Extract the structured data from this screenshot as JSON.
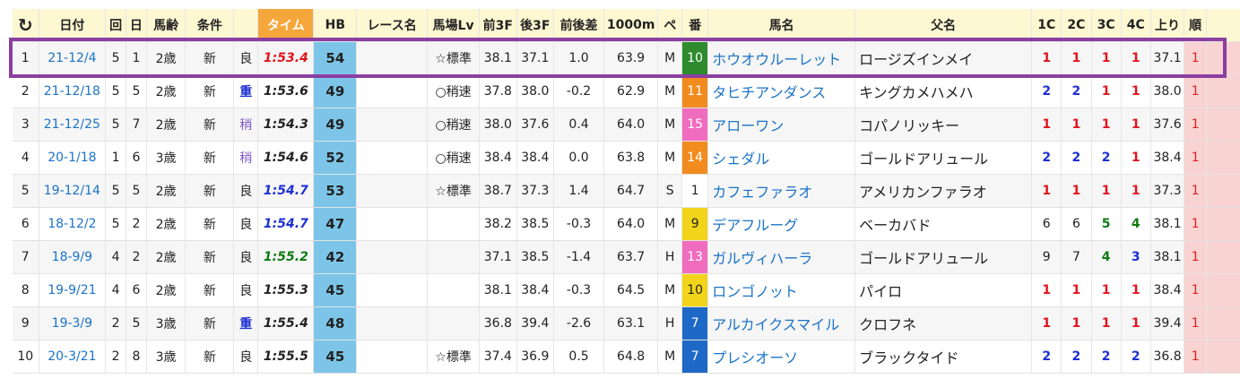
{
  "headers": {
    "refresh_icon": "↻",
    "date": "日付",
    "kai": "回",
    "day": "日",
    "age": "馬齢",
    "cond": "条件",
    "time": "タイム",
    "hb": "HB",
    "race_name": "レース名",
    "track_lv": "馬場Lv",
    "f3": "前3F",
    "l3": "後3F",
    "diff": "前後差",
    "m1000": "1000m",
    "pe": "ペ",
    "num": "番",
    "horse": "馬名",
    "sire": "父名",
    "c1": "1C",
    "c2": "2C",
    "c3": "3C",
    "c4": "4C",
    "agari": "上り",
    "rank": "順"
  },
  "colors": {
    "time_header": "#f5a73b",
    "hb_cell": "#7cc5e8",
    "rank_cell": "#f9d2d2",
    "highlight_border": "#8b3ea0"
  },
  "rows": [
    {
      "idx": "1",
      "date": "21-12/4",
      "kai": "5",
      "day": "1",
      "age": "2歳",
      "cond": "新",
      "track": "良",
      "time": "1:53.4",
      "time_color": "#e0141e",
      "hb": "54",
      "race_name": "",
      "lv": "☆標準",
      "f3": "38.1",
      "l3": "37.1",
      "diff": "1.0",
      "m1000": "63.9",
      "pe": "M",
      "num": "10",
      "num_bg": "#2e8b2e",
      "num_fg": "#ffffff",
      "horse": "ホウオウルーレット",
      "sire": "ロージズインメイ",
      "c1": "1",
      "c1c": "red",
      "c2": "1",
      "c2c": "red",
      "c3": "1",
      "c3c": "red",
      "c4": "1",
      "c4c": "red",
      "agari": "37.1",
      "rank": "1"
    },
    {
      "idx": "2",
      "date": "21-12/18",
      "kai": "5",
      "day": "5",
      "age": "2歳",
      "cond": "新",
      "track": "重",
      "time": "1:53.6",
      "time_color": "#222222",
      "hb": "49",
      "race_name": "",
      "lv": "○稍速",
      "f3": "37.8",
      "l3": "38.0",
      "diff": "-0.2",
      "m1000": "62.9",
      "pe": "M",
      "num": "11",
      "num_bg": "#f28c1e",
      "num_fg": "#ffffff",
      "horse": "タヒチアンダンス",
      "sire": "キングカメハメハ",
      "c1": "2",
      "c1c": "blue",
      "c2": "2",
      "c2c": "blue",
      "c3": "1",
      "c3c": "red",
      "c4": "1",
      "c4c": "red",
      "agari": "38.0",
      "rank": "1"
    },
    {
      "idx": "3",
      "date": "21-12/25",
      "kai": "5",
      "day": "7",
      "age": "2歳",
      "cond": "新",
      "track": "稍",
      "time": "1:54.3",
      "time_color": "#222222",
      "hb": "49",
      "race_name": "",
      "lv": "○稍速",
      "f3": "38.0",
      "l3": "37.6",
      "diff": "0.4",
      "m1000": "64.0",
      "pe": "M",
      "num": "15",
      "num_bg": "#f06cbf",
      "num_fg": "#ffffff",
      "horse": "アローワン",
      "sire": "コパノリッキー",
      "c1": "1",
      "c1c": "red",
      "c2": "1",
      "c2c": "red",
      "c3": "1",
      "c3c": "red",
      "c4": "1",
      "c4c": "red",
      "agari": "37.6",
      "rank": "1"
    },
    {
      "idx": "4",
      "date": "20-1/18",
      "kai": "1",
      "day": "6",
      "age": "3歳",
      "cond": "新",
      "track": "稍",
      "time": "1:54.6",
      "time_color": "#222222",
      "hb": "52",
      "race_name": "",
      "lv": "○稍速",
      "f3": "38.4",
      "l3": "38.4",
      "diff": "0.0",
      "m1000": "63.8",
      "pe": "M",
      "num": "14",
      "num_bg": "#f28c1e",
      "num_fg": "#ffffff",
      "horse": "シェダル",
      "sire": "ゴールドアリュール",
      "c1": "2",
      "c1c": "blue",
      "c2": "2",
      "c2c": "blue",
      "c3": "2",
      "c3c": "blue",
      "c4": "1",
      "c4c": "red",
      "agari": "38.4",
      "rank": "1"
    },
    {
      "idx": "5",
      "date": "19-12/14",
      "kai": "5",
      "day": "5",
      "age": "2歳",
      "cond": "新",
      "track": "良",
      "time": "1:54.7",
      "time_color": "#1c2fd4",
      "hb": "53",
      "race_name": "",
      "lv": "☆標準",
      "f3": "38.7",
      "l3": "37.3",
      "diff": "1.4",
      "m1000": "64.7",
      "pe": "S",
      "num": "1",
      "num_bg": "transparent",
      "num_fg": "#222222",
      "horse": "カフェファラオ",
      "sire": "アメリカンファラオ",
      "c1": "1",
      "c1c": "red",
      "c2": "1",
      "c2c": "red",
      "c3": "1",
      "c3c": "red",
      "c4": "1",
      "c4c": "red",
      "agari": "37.3",
      "rank": "1"
    },
    {
      "idx": "6",
      "date": "18-12/2",
      "kai": "5",
      "day": "2",
      "age": "2歳",
      "cond": "新",
      "track": "良",
      "time": "1:54.7",
      "time_color": "#1c2fd4",
      "hb": "47",
      "race_name": "",
      "lv": "",
      "f3": "38.2",
      "l3": "38.5",
      "diff": "-0.3",
      "m1000": "64.0",
      "pe": "M",
      "num": "9",
      "num_bg": "#f2d51a",
      "num_fg": "#222222",
      "horse": "デアフルーグ",
      "sire": "ベーカバド",
      "c1": "6",
      "c1c": "plain",
      "c2": "6",
      "c2c": "plain",
      "c3": "5",
      "c3c": "green",
      "c4": "4",
      "c4c": "green",
      "agari": "38.1",
      "rank": "1"
    },
    {
      "idx": "7",
      "date": "18-9/9",
      "kai": "4",
      "day": "2",
      "age": "2歳",
      "cond": "新",
      "track": "良",
      "time": "1:55.2",
      "time_color": "#0f7a12",
      "hb": "42",
      "race_name": "",
      "lv": "",
      "f3": "37.1",
      "l3": "38.5",
      "diff": "-1.4",
      "m1000": "63.7",
      "pe": "H",
      "num": "13",
      "num_bg": "#f06cbf",
      "num_fg": "#ffffff",
      "horse": "ガルヴィハーラ",
      "sire": "ゴールドアリュール",
      "c1": "9",
      "c1c": "plain",
      "c2": "7",
      "c2c": "plain",
      "c3": "4",
      "c3c": "green",
      "c4": "3",
      "c4c": "blue",
      "agari": "38.1",
      "rank": "1"
    },
    {
      "idx": "8",
      "date": "19-9/21",
      "kai": "4",
      "day": "6",
      "age": "2歳",
      "cond": "新",
      "track": "良",
      "time": "1:55.3",
      "time_color": "#222222",
      "hb": "45",
      "race_name": "",
      "lv": "",
      "f3": "38.1",
      "l3": "38.4",
      "diff": "-0.3",
      "m1000": "64.5",
      "pe": "M",
      "num": "10",
      "num_bg": "#f2d51a",
      "num_fg": "#222222",
      "horse": "ロンゴノット",
      "sire": "パイロ",
      "c1": "1",
      "c1c": "red",
      "c2": "1",
      "c2c": "red",
      "c3": "1",
      "c3c": "red",
      "c4": "1",
      "c4c": "red",
      "agari": "38.4",
      "rank": "1"
    },
    {
      "idx": "9",
      "date": "19-3/9",
      "kai": "2",
      "day": "5",
      "age": "3歳",
      "cond": "新",
      "track": "重",
      "time": "1:55.4",
      "time_color": "#222222",
      "hb": "48",
      "race_name": "",
      "lv": "",
      "f3": "36.8",
      "l3": "39.4",
      "diff": "-2.6",
      "m1000": "63.1",
      "pe": "H",
      "num": "7",
      "num_bg": "#1e68c8",
      "num_fg": "#ffffff",
      "horse": "アルカイクスマイル",
      "sire": "クロフネ",
      "c1": "1",
      "c1c": "red",
      "c2": "1",
      "c2c": "red",
      "c3": "1",
      "c3c": "red",
      "c4": "1",
      "c4c": "red",
      "agari": "39.4",
      "rank": "1"
    },
    {
      "idx": "10",
      "date": "20-3/21",
      "kai": "2",
      "day": "8",
      "age": "3歳",
      "cond": "新",
      "track": "良",
      "time": "1:55.5",
      "time_color": "#222222",
      "hb": "45",
      "race_name": "",
      "lv": "☆標準",
      "f3": "37.4",
      "l3": "36.9",
      "diff": "0.5",
      "m1000": "64.8",
      "pe": "M",
      "num": "7",
      "num_bg": "#1e68c8",
      "num_fg": "#ffffff",
      "horse": "プレシオーソ",
      "sire": "ブラックタイド",
      "c1": "2",
      "c1c": "blue",
      "c2": "2",
      "c2c": "blue",
      "c3": "2",
      "c3c": "blue",
      "c4": "2",
      "c4c": "blue",
      "agari": "36.8",
      "rank": "1"
    }
  ]
}
